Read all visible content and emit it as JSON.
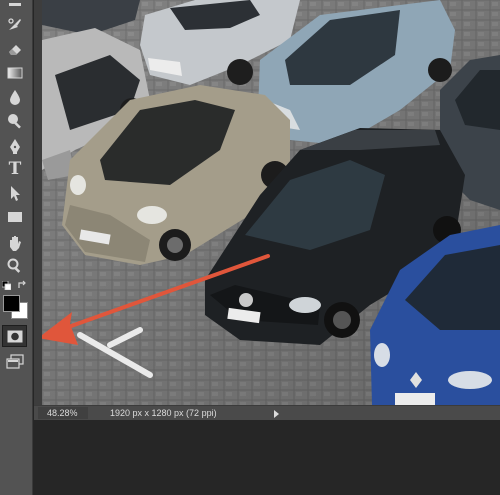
{
  "app": {
    "accent_arrow_color": "#e0563b",
    "toolbar_color": "#535353"
  },
  "toolbar": {
    "tools": [
      "eraser-icon",
      "gradient-icon",
      "blur-icon",
      "dodge-icon",
      "pen-icon",
      "type-tool",
      "path-selection-icon",
      "rectangle-shape-icon",
      "hand-icon",
      "zoom-icon"
    ],
    "type_tool_label": "T",
    "foreground_color": "#000000",
    "background_color": "#ffffff"
  },
  "status": {
    "zoom": "48.28%",
    "document_info": "1920 px x 1280 px (72 ppi)"
  }
}
